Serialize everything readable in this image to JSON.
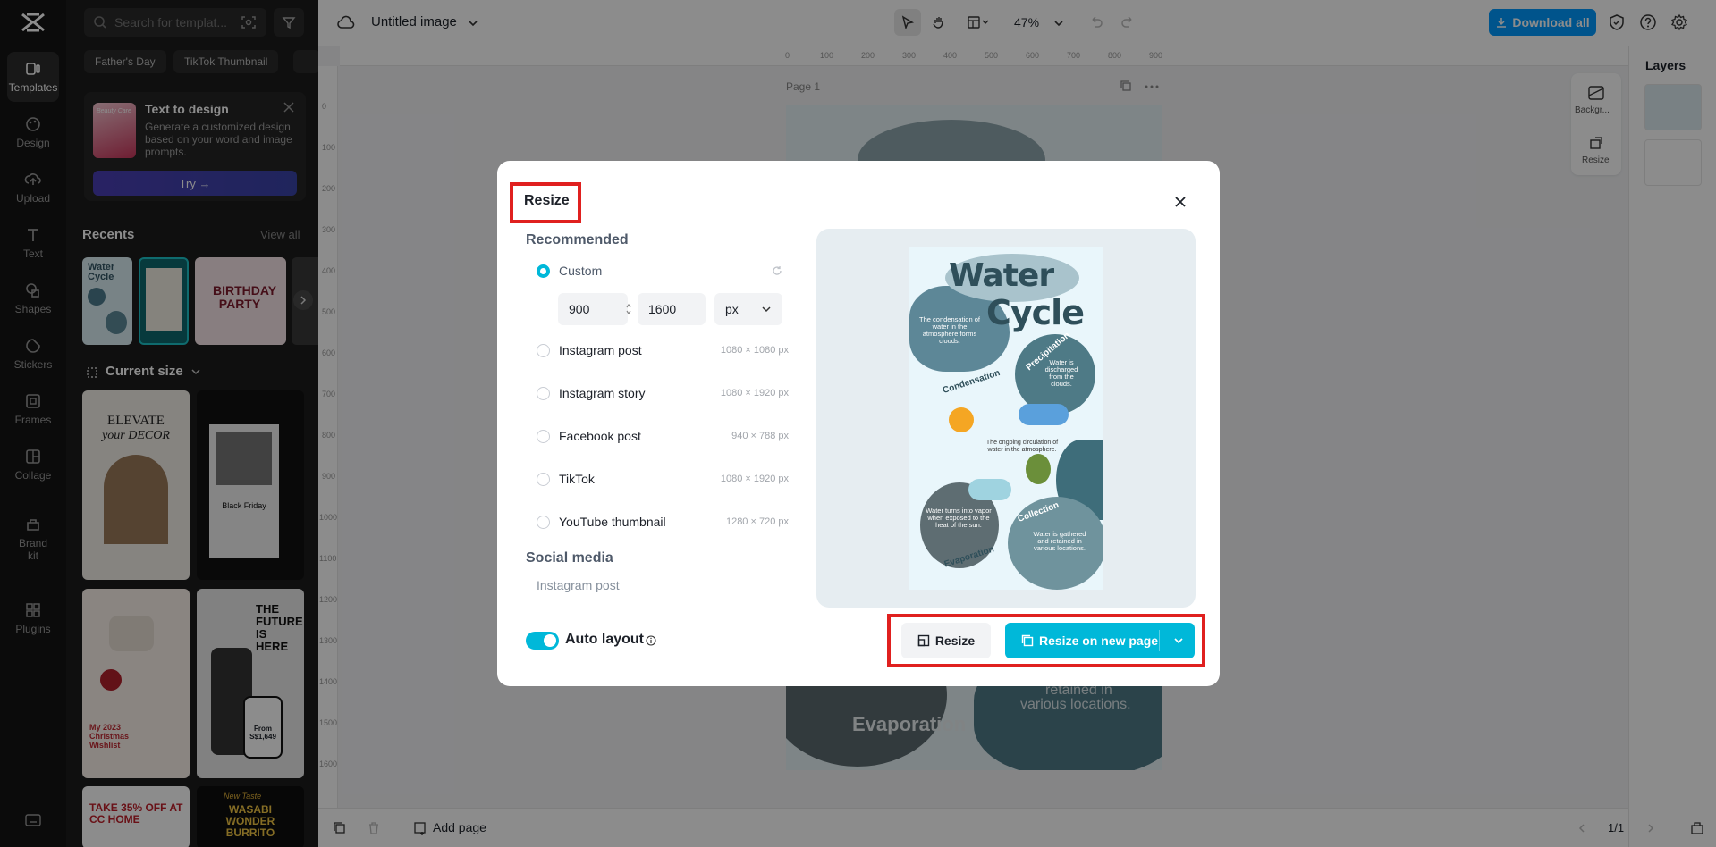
{
  "sidebar": {
    "items": [
      {
        "label": "Templates",
        "icon": "templates-icon"
      },
      {
        "label": "Design",
        "icon": "design-icon"
      },
      {
        "label": "Upload",
        "icon": "upload-icon"
      },
      {
        "label": "Text",
        "icon": "text-icon"
      },
      {
        "label": "Shapes",
        "icon": "shapes-icon"
      },
      {
        "label": "Stickers",
        "icon": "stickers-icon"
      },
      {
        "label": "Frames",
        "icon": "frames-icon"
      },
      {
        "label": "Collage",
        "icon": "collage-icon"
      },
      {
        "label": "Brand",
        "label2": "kit",
        "icon": "brand-kit-icon"
      },
      {
        "label": "Plugins",
        "icon": "plugins-icon"
      }
    ]
  },
  "panel": {
    "search_placeholder": "Search for templat...",
    "chips": [
      "Father's Day",
      "TikTok Thumbnail"
    ],
    "promo": {
      "title": "Text to design",
      "description": "Generate a customized design based on your word and image prompts.",
      "thumb_text": "Beauty Care",
      "button": "Try →"
    },
    "recents_title": "Recents",
    "view_all": "View all",
    "recents_thumb_text": [
      "Water Cycle",
      "BIRTHDAY PARTY"
    ],
    "current_size": "Current size",
    "templates": [
      {
        "line1": "ELEVATE",
        "line2": "your DECOR"
      },
      {
        "line1": "Black Friday",
        "line2": ""
      },
      {
        "line1": "My 2023 Christmas Wishlist",
        "line2": ""
      },
      {
        "line1": "THE FUTURE IS HERE",
        "line2": "From S$1,649"
      },
      {
        "line1": "TAKE 35% OFF AT CC HOME",
        "line2": ""
      },
      {
        "line1": "New Taste",
        "line2": "WASABI WONDER BURRITO"
      }
    ]
  },
  "topbar": {
    "title": "Untitled image",
    "zoom": "47%",
    "download": "Download all"
  },
  "ruler": {
    "h": [
      "0",
      "100",
      "200",
      "300",
      "400",
      "500",
      "600",
      "700",
      "800",
      "900"
    ],
    "v": [
      "0",
      "100",
      "200",
      "300",
      "400",
      "500",
      "600",
      "700",
      "800",
      "900",
      "1000",
      "1100",
      "1200",
      "1300",
      "1400",
      "1500",
      "1600"
    ]
  },
  "canvas": {
    "page_label": "Page 1",
    "bg_texts": {
      "evaporation": "Evaporation",
      "retained": "retained in",
      "locations": "various locations."
    }
  },
  "right_tools": {
    "background": "Backgr...",
    "resize": "Resize"
  },
  "layers": {
    "title": "Layers"
  },
  "bottombar": {
    "add_page": "Add page",
    "page_count": "1/1"
  },
  "modal": {
    "title": "Resize",
    "recommended": "Recommended",
    "custom_label": "Custom",
    "width": "900",
    "height": "1600",
    "unit": "px",
    "options": [
      {
        "label": "Instagram post",
        "size": "1080 × 1080 px"
      },
      {
        "label": "Instagram story",
        "size": "1080 × 1920 px"
      },
      {
        "label": "Facebook post",
        "size": "940 × 788 px"
      },
      {
        "label": "TikTok",
        "size": "1080 × 1920 px"
      },
      {
        "label": "YouTube thumbnail",
        "size": "1280 × 720 px"
      }
    ],
    "social_media": "Social media",
    "social_sub": "Instagram post",
    "auto_layout": "Auto layout",
    "resize_button": "Resize",
    "resize_new_page_button": "Resize on new page",
    "preview": {
      "title1": "Water",
      "title2": "Cycle",
      "condensation_text": "The condensation of water in the atmosphere forms clouds.",
      "condensation": "Condensation",
      "precipitation": "Precipitation",
      "precip_text": "Water is discharged from the clouds.",
      "circulation_text": "The ongoing circulation of water in the atmosphere.",
      "evap_text": "Water turns into vapor when exposed to the heat of the sun.",
      "evaporation": "Evaporation",
      "collection": "Collection",
      "collection_text": "Water is gathered and retained in various locations."
    }
  },
  "colors": {
    "accent": "#00b8d9",
    "highlight": "#e0201f",
    "download": "#0099ff"
  }
}
